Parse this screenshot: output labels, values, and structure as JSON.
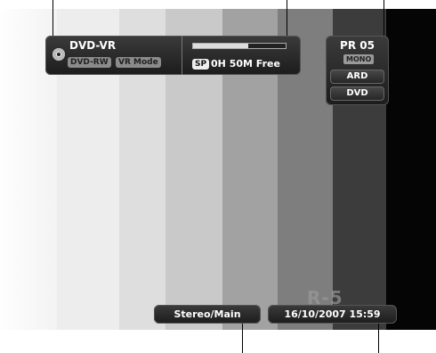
{
  "disc": {
    "type": "DVD-VR",
    "media_badge": "DVD-RW",
    "mode_badge": "VR Mode",
    "record_mode": "SP",
    "free_space": "0H 50M Free",
    "usage_fraction": 0.6
  },
  "program": {
    "number": "PR 05",
    "audio_badge": "MONO",
    "station": "ARD",
    "source": "DVD"
  },
  "audio": {
    "label": "Stereo/Main"
  },
  "clock": {
    "date_time": "16/10/2007  15:59"
  },
  "watermark": {
    "text": "R-5"
  },
  "colors": {
    "osd_background": "#2a2a2a",
    "osd_text": "#ffffff"
  },
  "icons": [
    "disc-icon"
  ]
}
